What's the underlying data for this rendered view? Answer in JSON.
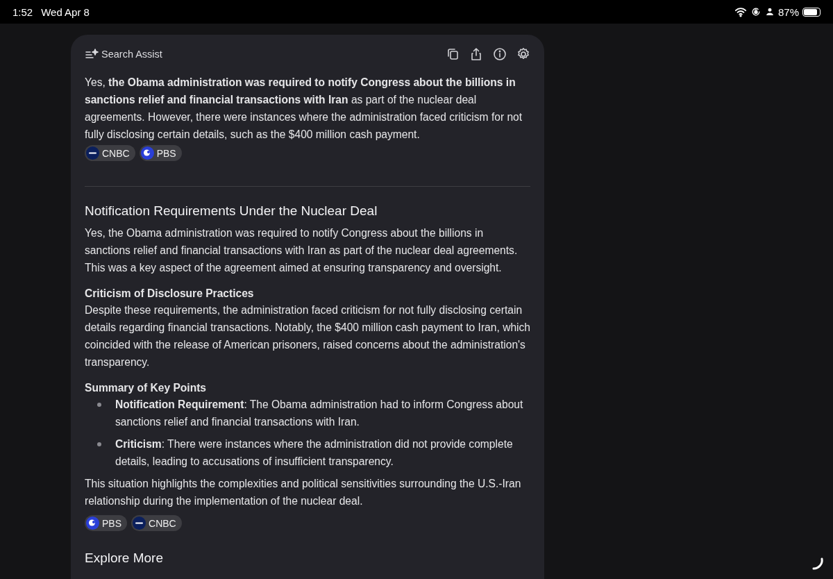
{
  "status_bar": {
    "time": "1:52",
    "date": "Wed Apr 8",
    "battery": "87%"
  },
  "assist": {
    "title": "Search Assist",
    "summary": "Yes, **the Obama administration was required to notify Congress about the billions in sanctions relief and financial transactions with Iran** as part of the nuclear deal agreements. However, there were instances where the administration faced criticism for not fully disclosing certain details, such as the $400 million cash payment.",
    "summary_sources": [
      {
        "kind": "cnbc",
        "label": "CNBC"
      },
      {
        "kind": "pbs",
        "label": "PBS"
      }
    ],
    "heading": "Notification Requirements Under the Nuclear Deal",
    "intro": "Yes, the Obama administration was required to notify Congress about the billions in sanctions relief and financial transactions with Iran as part of the nuclear deal agreements. This was a key aspect of the agreement aimed at ensuring transparency and oversight.",
    "sections": [
      {
        "title": "Criticism of Disclosure Practices",
        "text": "Despite these requirements, the administration faced criticism for not fully disclosing certain details regarding financial transactions. Notably, the $400 million cash payment to Iran, which coincided with the release of American prisoners, raised concerns about the administration's transparency."
      },
      {
        "title": "Summary of Key Points",
        "bullets": [
          "**Notification Requirement**: The Obama administration had to inform Congress about sanctions relief and financial transactions with Iran.",
          "**Criticism**: There were instances where the administration did not provide complete details, leading to accusations of insufficient transparency."
        ]
      }
    ],
    "conclusion": "This situation highlights the complexities and political sensitivities surrounding the U.S.-Iran relationship during the implementation of the nuclear deal.",
    "sources": [
      {
        "kind": "pbs",
        "label": "PBS"
      },
      {
        "kind": "cnbc",
        "label": "CNBC"
      }
    ],
    "next_heading": "Explore More"
  }
}
